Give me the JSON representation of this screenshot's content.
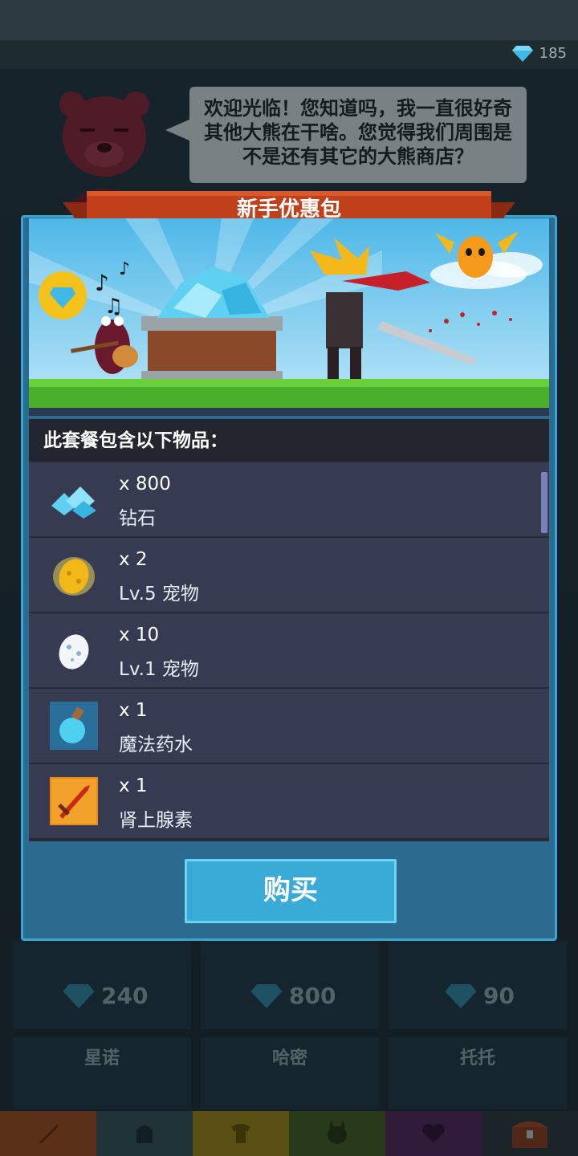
{
  "header": {
    "gem_count": "185"
  },
  "npc": {
    "speech": "欢迎光临！您知道吗，我一直很好奇其他大熊在干啥。您觉得我们周围是不是还有其它的大熊商店？"
  },
  "dialog": {
    "title": "新手优惠包",
    "list_header": "此套餐包含以下物品：",
    "items": [
      {
        "qty": "x 800",
        "name": "钻石",
        "icon": "diamond-pile-icon"
      },
      {
        "qty": "x 2",
        "name": "Lv.5 宠物",
        "icon": "golden-egg-icon"
      },
      {
        "qty": "x 10",
        "name": "Lv.1 宠物",
        "icon": "spotted-egg-icon"
      },
      {
        "qty": "x 1",
        "name": "魔法药水",
        "icon": "potion-icon"
      },
      {
        "qty": "x 1",
        "name": "肾上腺素",
        "icon": "sword-icon"
      }
    ],
    "buy_label": "购买"
  },
  "shop_behind": {
    "prices": [
      "240",
      "800",
      "90"
    ],
    "names": [
      "星诺",
      "哈密",
      "托托"
    ]
  },
  "colors": {
    "dialog_border": "#3ea4d6",
    "dialog_fill": "#2a6b8f",
    "ribbon": "#c0401c",
    "item_row": "#373b52",
    "buy_button": "#3aaad6"
  }
}
